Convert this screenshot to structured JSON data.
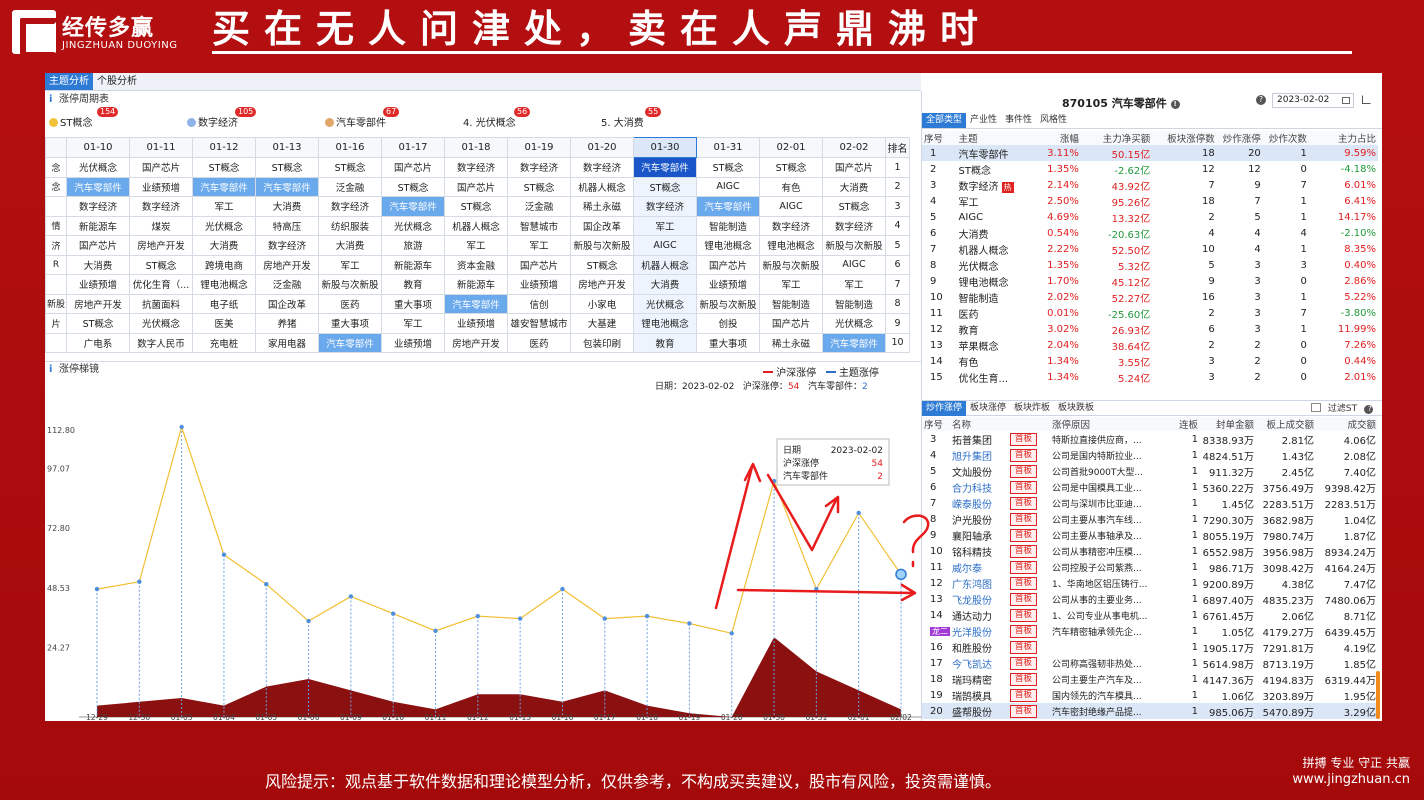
{
  "brand": {
    "cn": "经传多赢",
    "en": "JINGZHUAN DUOYING"
  },
  "slogan": "买在无人问津处，卖在人声鼎沸时",
  "tabs": [
    "主题分析",
    "个股分析"
  ],
  "ranking_title": "涨停周期表",
  "top_themes": [
    {
      "label": "ST概念",
      "count": "154",
      "color": "#f0c23a"
    },
    {
      "label": "数字经济",
      "count": "105",
      "color": "#8fb3e8"
    },
    {
      "label": "汽车零部件",
      "count": "67",
      "color": "#e2a56a"
    },
    {
      "label": "4. 光伏概念",
      "count": "56",
      "color": ""
    },
    {
      "label": "5. 大消费",
      "count": "55",
      "color": ""
    }
  ],
  "grid": {
    "left_stub": [
      "念",
      "念",
      "",
      "情",
      "济",
      "R",
      "",
      "新股",
      "片",
      ""
    ],
    "dates": [
      "01-10",
      "01-11",
      "01-12",
      "01-13",
      "01-16",
      "01-17",
      "01-18",
      "01-19",
      "01-20",
      "01-30",
      "01-31",
      "02-01",
      "02-02"
    ],
    "rank_header": "排名",
    "rows": [
      [
        "光伏概念",
        "国产芯片",
        "ST概念",
        "ST概念",
        "ST概念",
        "国产芯片",
        "数字经济",
        "数字经济",
        "数字经济",
        "汽车零部件",
        "ST概念",
        "ST概念",
        "国产芯片"
      ],
      [
        "汽车零部件",
        "业绩预增",
        "汽车零部件",
        "汽车零部件",
        "泛金融",
        "ST概念",
        "国产芯片",
        "ST概念",
        "机器人概念",
        "ST概念",
        "AIGC",
        "有色",
        "大消费"
      ],
      [
        "数字经济",
        "数字经济",
        "军工",
        "大消费",
        "数字经济",
        "汽车零部件",
        "ST概念",
        "泛金融",
        "稀土永磁",
        "数字经济",
        "汽车零部件",
        "AIGC",
        "ST概念"
      ],
      [
        "新能源车",
        "煤炭",
        "光伏概念",
        "特高压",
        "纺织服装",
        "光伏概念",
        "机器人概念",
        "智慧城市",
        "国企改革",
        "军工",
        "智能制造",
        "数字经济",
        "数字经济"
      ],
      [
        "国产芯片",
        "房地产开发",
        "大消费",
        "数字经济",
        "大消费",
        "旅游",
        "军工",
        "军工",
        "新股与次新股",
        "AIGC",
        "锂电池概念",
        "锂电池概念",
        "新股与次新股"
      ],
      [
        "大消费",
        "ST概念",
        "跨境电商",
        "房地产开发",
        "军工",
        "新能源车",
        "资本金融",
        "国产芯片",
        "ST概念",
        "机器人概念",
        "国产芯片",
        "新股与次新股",
        "AIGC"
      ],
      [
        "业绩预增",
        "优化生育（...",
        "锂电池概念",
        "泛金融",
        "新股与次新股",
        "教育",
        "新能源车",
        "业绩预增",
        "房地产开发",
        "大消费",
        "业绩预增",
        "军工",
        "军工"
      ],
      [
        "房地产开发",
        "抗菌面料",
        "电子纸",
        "国企改革",
        "医药",
        "重大事项",
        "汽车零部件",
        "信创",
        "小家电",
        "光伏概念",
        "新股与次新股",
        "智能制造",
        "智能制造"
      ],
      [
        "ST概念",
        "光伏概念",
        "医美",
        "养猪",
        "重大事项",
        "军工",
        "业绩预增",
        "雄安智慧城市",
        "大基建",
        "锂电池概念",
        "创投",
        "国产芯片",
        "光伏概念"
      ],
      [
        "广电系",
        "数字人民币",
        "充电桩",
        "家用电器",
        "汽车零部件",
        "业绩预增",
        "房地产开发",
        "医药",
        "包装印刷",
        "教育",
        "重大事项",
        "稀土永磁",
        "汽车零部件"
      ]
    ],
    "ranks": [
      "1",
      "2",
      "3",
      "4",
      "5",
      "6",
      "7",
      "8",
      "9",
      "10"
    ]
  },
  "chart_panel": {
    "title": "涨停梯镜",
    "legend": [
      {
        "label": "沪深涨停",
        "color": "#e12020"
      },
      {
        "label": "主题涨停",
        "color": "#2e6fc7"
      }
    ],
    "info": {
      "date_label": "日期：",
      "date": "2023-02-02",
      "a_label": "沪深涨停：",
      "a_value": "54",
      "b_label": "汽车零部件：",
      "b_value": "2"
    },
    "tooltip": {
      "date_label": "日期",
      "date": "2023-02-02",
      "a_label": "沪深涨停",
      "a_value": "54",
      "b_label": "汽车零部件",
      "b_value": "2"
    }
  },
  "chart_data": {
    "type": "line",
    "x": [
      "12-29",
      "12-30",
      "01-03",
      "01-04",
      "01-05",
      "01-06",
      "01-09",
      "01-10",
      "01-11",
      "01-12",
      "01-13",
      "01-16",
      "01-17",
      "01-18",
      "01-19",
      "01-20",
      "01-30",
      "01-31",
      "02-01",
      "02/02"
    ],
    "x_tick_labels": [
      "12-29",
      "12-30",
      "01-03",
      "01-04",
      "01-05",
      "01-06",
      "01-09",
      "01-10",
      "01-11",
      "01-12",
      "01-13",
      "01-16",
      "01-17",
      "01-18",
      "01-19",
      "01-20",
      "01-30",
      "01-31",
      "02-01",
      "02/02",
      "02"
    ],
    "y_ticks": [
      "112.80",
      "97.07",
      "72.80",
      "48.53",
      "24.27"
    ],
    "ylim": [
      0,
      121.33
    ],
    "series": [
      {
        "name": "沪深涨停",
        "values": [
          48,
          51,
          114,
          62,
          50,
          35,
          45,
          38,
          31,
          37,
          36,
          48,
          36,
          37,
          34,
          30,
          92,
          48,
          79,
          54
        ],
        "color": "#f2bf33"
      },
      {
        "name": "主题涨停",
        "values": [
          3,
          4,
          5,
          3,
          8,
          10,
          7,
          4,
          2,
          6,
          6,
          4,
          7,
          3,
          1,
          0,
          21,
          12,
          7,
          2
        ],
        "color": "#8b1010"
      }
    ]
  },
  "right_panel": {
    "code": "870105",
    "name": "汽车零部件",
    "date": "2023-02-02",
    "tabs": [
      "全部类型",
      "产业性",
      "事件性",
      "风格性"
    ],
    "columns": [
      "序号",
      "主题",
      "涨幅",
      "主力净买额",
      "板块涨停数",
      "炒作涨停",
      "炒作次数",
      "主力占比"
    ],
    "rows": [
      [
        "1",
        "汽车零部件",
        "3.11%",
        "50.15亿",
        "18",
        "20",
        "1",
        "9.59%"
      ],
      [
        "2",
        "ST概念",
        "1.35%",
        "-2.62亿",
        "12",
        "12",
        "0",
        "-4.18%"
      ],
      [
        "3",
        "数字经济",
        "2.14%",
        "43.92亿",
        "7",
        "9",
        "7",
        "6.01%"
      ],
      [
        "4",
        "军工",
        "2.50%",
        "95.26亿",
        "18",
        "7",
        "1",
        "6.41%"
      ],
      [
        "5",
        "AIGC",
        "4.69%",
        "13.32亿",
        "2",
        "5",
        "1",
        "14.17%"
      ],
      [
        "6",
        "大消费",
        "0.54%",
        "-20.63亿",
        "4",
        "4",
        "4",
        "-2.10%"
      ],
      [
        "7",
        "机器人概念",
        "2.22%",
        "52.50亿",
        "10",
        "4",
        "1",
        "8.35%"
      ],
      [
        "8",
        "光伏概念",
        "1.35%",
        "5.32亿",
        "5",
        "3",
        "3",
        "0.40%"
      ],
      [
        "9",
        "锂电池概念",
        "1.70%",
        "45.12亿",
        "9",
        "3",
        "0",
        "2.86%"
      ],
      [
        "10",
        "智能制造",
        "2.02%",
        "52.27亿",
        "16",
        "3",
        "1",
        "5.22%"
      ],
      [
        "11",
        "医药",
        "0.01%",
        "-25.60亿",
        "2",
        "3",
        "7",
        "-3.80%"
      ],
      [
        "12",
        "教育",
        "3.02%",
        "26.93亿",
        "6",
        "3",
        "1",
        "11.99%"
      ],
      [
        "13",
        "苹果概念",
        "2.04%",
        "38.64亿",
        "2",
        "2",
        "0",
        "7.26%"
      ],
      [
        "14",
        "有色",
        "1.34%",
        "3.55亿",
        "3",
        "2",
        "0",
        "0.44%"
      ],
      [
        "15",
        "优化生育...",
        "1.34%",
        "5.24亿",
        "3",
        "2",
        "0",
        "2.01%"
      ]
    ],
    "hot_label": "热",
    "stock_tabs": [
      "炒作涨停",
      "板块涨停",
      "板块炸板",
      "板块跌板"
    ],
    "filter_label": "过滤ST",
    "stock_columns": [
      "序号",
      "名称",
      "",
      "涨停原因",
      "连板",
      "封单金额",
      "板上成交额",
      "成交额"
    ],
    "stocks": [
      [
        "3",
        "拓普集团",
        "首板",
        "特斯拉直接供应商，...",
        "1",
        "8338.93万",
        "2.81亿",
        "4.06亿"
      ],
      [
        "4",
        "旭升集团",
        "首板",
        "公司是国内特斯拉业...",
        "1",
        "4824.51万",
        "1.43亿",
        "2.08亿"
      ],
      [
        "5",
        "文灿股份",
        "首板",
        "公司首批9000T大型...",
        "1",
        "911.32万",
        "2.45亿",
        "7.40亿"
      ],
      [
        "6",
        "合力科技",
        "首板",
        "公司是中国模具工业...",
        "1",
        "5360.22万",
        "3756.49万",
        "9398.42万"
      ],
      [
        "7",
        "嵘泰股份",
        "首板",
        "公司与深圳市比亚迪...",
        "1",
        "1.45亿",
        "2283.51万",
        "2283.51万"
      ],
      [
        "8",
        "沪光股份",
        "首板",
        "公司主要从事汽车线...",
        "1",
        "7290.30万",
        "3682.98万",
        "1.04亿"
      ],
      [
        "9",
        "襄阳轴承",
        "首板",
        "公司主要从事轴承及...",
        "1",
        "8055.19万",
        "7980.74万",
        "1.87亿"
      ],
      [
        "10",
        "铭科精技",
        "首板",
        "公司从事精密冲压模...",
        "1",
        "6552.98万",
        "3956.98万",
        "8934.24万"
      ],
      [
        "11",
        "威尔泰",
        "首板",
        "公司控股子公司紫燕...",
        "1",
        "986.71万",
        "3098.42万",
        "4164.24万"
      ],
      [
        "12",
        "广东鸿图",
        "首板",
        "1、华南地区铝压铸行...",
        "1",
        "9200.89万",
        "4.38亿",
        "7.47亿"
      ],
      [
        "13",
        "飞龙股份",
        "首板",
        "公司从事的主要业务...",
        "1",
        "6897.40万",
        "4835.23万",
        "7480.06万"
      ],
      [
        "14",
        "通达动力",
        "首板",
        "1、公司专业从事电机...",
        "1",
        "6761.45万",
        "2.06亿",
        "8.71亿"
      ],
      [
        "15",
        "光洋股份",
        "首板",
        "汽车精密轴承领先企...",
        "1",
        "1.05亿",
        "4179.27万",
        "6439.45万"
      ],
      [
        "16",
        "和胜股份",
        "首板",
        "",
        "1",
        "1905.17万",
        "7291.81万",
        "4.19亿"
      ],
      [
        "17",
        "今飞凯达",
        "首板",
        "公司称高强韧非热处...",
        "1",
        "5614.98万",
        "8713.19万",
        "1.85亿"
      ],
      [
        "18",
        "瑞玛精密",
        "首板",
        "公司主要生产汽车及...",
        "1",
        "4147.36万",
        "4194.83万",
        "6319.44万"
      ],
      [
        "19",
        "瑞鹄模具",
        "首板",
        "国内领先的汽车模具...",
        "1",
        "1.06亿",
        "3203.89万",
        "1.95亿"
      ],
      [
        "20",
        "盛帮股份",
        "首板",
        "汽车密封绝缘产品提...",
        "1",
        "985.06万",
        "5470.89万",
        "3.29亿"
      ]
    ],
    "dragon_label": "龙二"
  },
  "footer": {
    "risk": "风险提示：观点基于软件数据和理论模型分析，仅供参考，不构成买卖建议，股市有风险，投资需谨慎。",
    "motto": "拼搏 专业 守正 共赢",
    "site": "www.jingzhuan.cn"
  }
}
